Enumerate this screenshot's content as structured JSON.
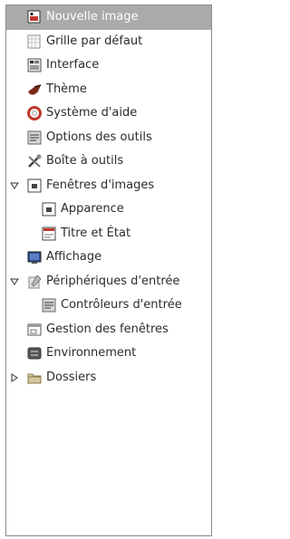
{
  "tree": {
    "items": [
      {
        "label": "Nouvelle image",
        "icon": "new-image-icon",
        "level": 0,
        "selected": true
      },
      {
        "label": "Grille par défaut",
        "icon": "grid-icon",
        "level": 0
      },
      {
        "label": "Interface",
        "icon": "interface-icon",
        "level": 0
      },
      {
        "label": "Thème",
        "icon": "theme-icon",
        "level": 0
      },
      {
        "label": "Système d'aide",
        "icon": "help-system-icon",
        "level": 0
      },
      {
        "label": "Options des outils",
        "icon": "tool-options-icon",
        "level": 0
      },
      {
        "label": "Boîte à outils",
        "icon": "toolbox-icon",
        "level": 0
      },
      {
        "label": "Fenêtres d'images",
        "icon": "image-windows-icon",
        "level": 0,
        "expander": "expanded"
      },
      {
        "label": "Apparence",
        "icon": "appearance-icon",
        "level": 1
      },
      {
        "label": "Titre et État",
        "icon": "title-status-icon",
        "level": 1
      },
      {
        "label": "Affichage",
        "icon": "display-icon",
        "level": 0
      },
      {
        "label": "Périphériques d'entrée",
        "icon": "input-devices-icon",
        "level": 0,
        "expander": "expanded"
      },
      {
        "label": "Contrôleurs d'entrée",
        "icon": "input-controllers-icon",
        "level": 1
      },
      {
        "label": "Gestion des fenêtres",
        "icon": "window-management-icon",
        "level": 0
      },
      {
        "label": "Environnement",
        "icon": "environment-icon",
        "level": 0
      },
      {
        "label": "Dossiers",
        "icon": "folders-icon",
        "level": 0,
        "expander": "collapsed"
      }
    ]
  }
}
